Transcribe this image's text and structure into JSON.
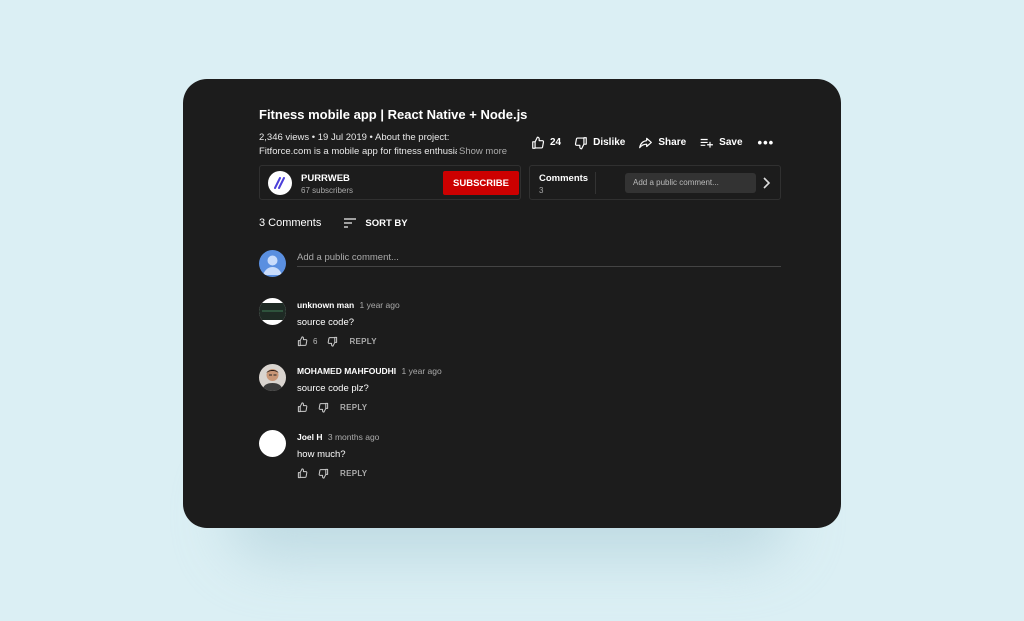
{
  "video": {
    "title": "Fitness mobile app | React Native + Node.js",
    "meta": "2,346 views • 19 Jul 2019 • About the project:",
    "desc_line2": "Fitforce.com is a mobile app for fitness enthusiasts",
    "show_more": "Show more"
  },
  "actions": {
    "like_count": "24",
    "dislike_label": "Dislike",
    "share_label": "Share",
    "save_label": "Save",
    "more": "•••"
  },
  "channel": {
    "name": "PURRWEB",
    "subscribers": "67 subscribers",
    "subscribe_label": "SUBSCRIBE",
    "logo_mark": "//",
    "logo_color": "#4b3fd9"
  },
  "comments_box": {
    "title": "Comments",
    "count": "3",
    "placeholder": "Add a public comment..."
  },
  "comments_section": {
    "count_label": "3 Comments",
    "sort_label": "SORT BY",
    "add_placeholder": "Add a public comment..."
  },
  "comments": [
    {
      "author": "unknown man",
      "time": "1 year ago",
      "text": "source code?",
      "likes": "6",
      "reply": "REPLY"
    },
    {
      "author": "MOHAMED MAHFOUDHI",
      "time": "1 year ago",
      "text": "source code plz?",
      "likes": "",
      "reply": "REPLY"
    },
    {
      "author": "Joel H",
      "time": "3 months ago",
      "text": "how much?",
      "likes": "",
      "reply": "REPLY"
    }
  ],
  "colors": {
    "background": "#dbeff4",
    "card": "#1c1c1c",
    "subscribe": "#cc0000",
    "avatar_default": "#5a8fe0"
  }
}
